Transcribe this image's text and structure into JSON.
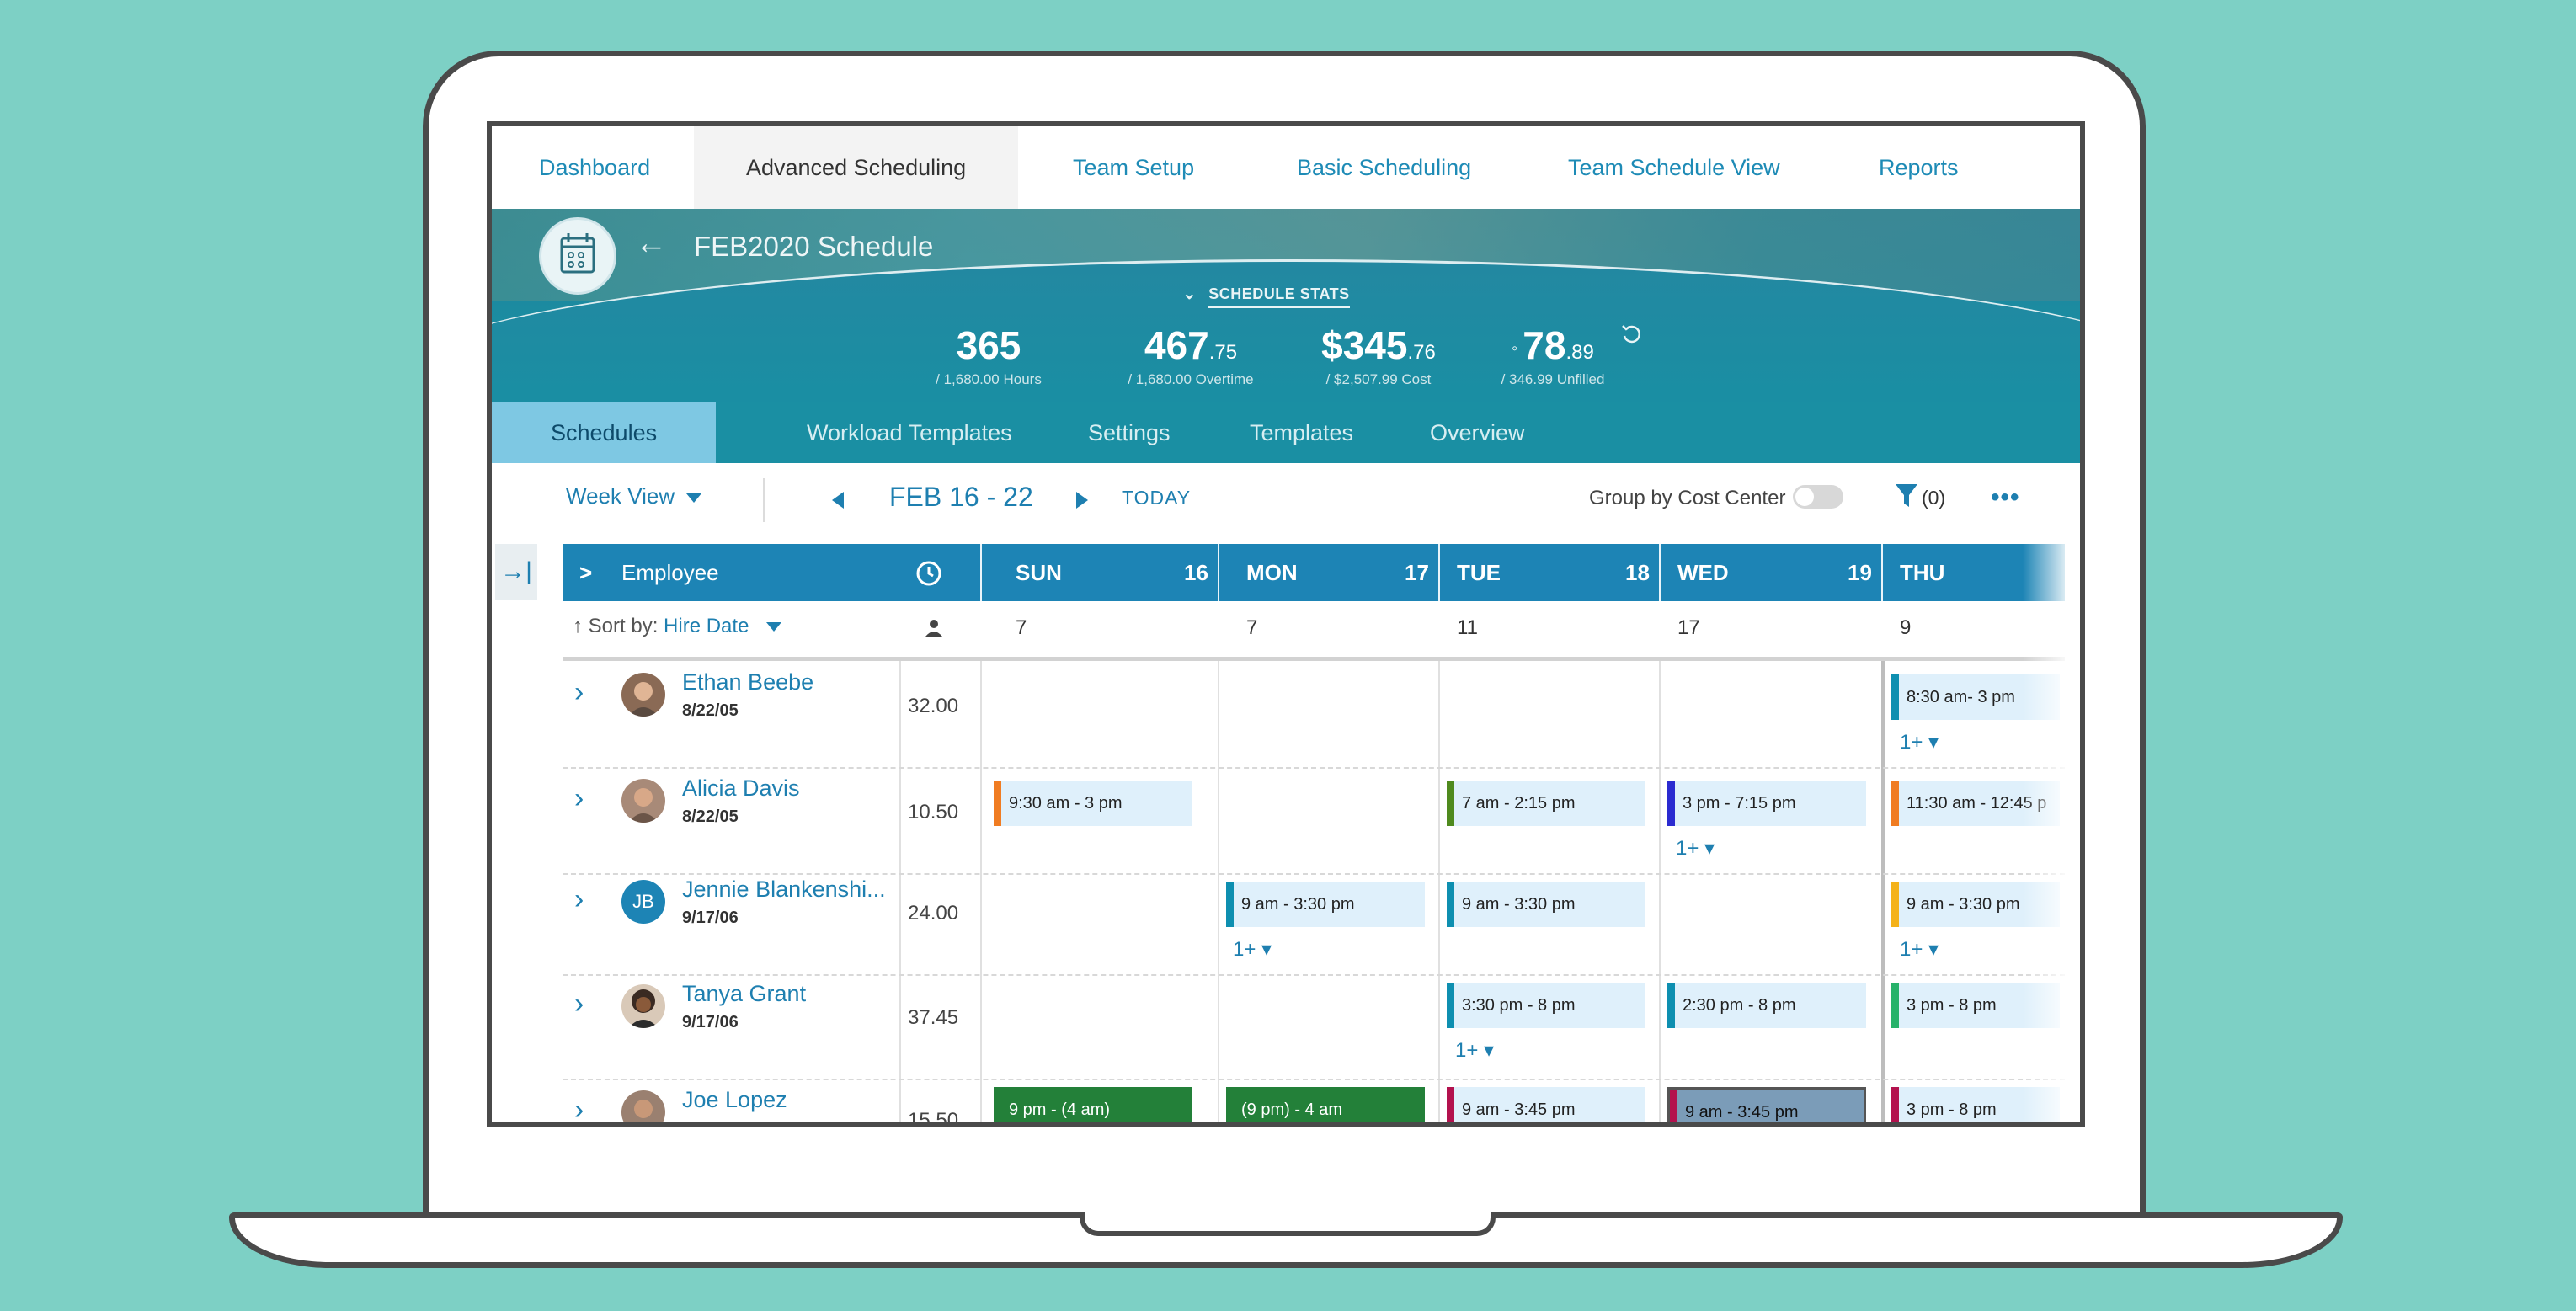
{
  "nav": {
    "items": [
      "Dashboard",
      "Advanced Scheduling",
      "Team Setup",
      "Basic Scheduling",
      "Team Schedule View",
      "Reports"
    ],
    "active": "Advanced Scheduling"
  },
  "banner": {
    "title": "FEB2020 Schedule",
    "stats_toggle": "SCHEDULE STATS",
    "stats": [
      {
        "main": "365",
        "dec": "",
        "sub": "/ 1,680.00 Hours"
      },
      {
        "main": "467",
        "dec": ".75",
        "sub": "/ 1,680.00 Overtime"
      },
      {
        "main": "$345",
        "dec": ".76",
        "sub": "/ $2,507.99 Cost"
      },
      {
        "main": "78",
        "dec": ".89",
        "sub": "/ 346.99 Unfilled"
      }
    ]
  },
  "subtabs": [
    "Schedules",
    "Workload Templates",
    "Settings",
    "Templates",
    "Overview"
  ],
  "toolbar": {
    "view": "Week View",
    "date_range": "FEB 16 - 22",
    "today": "TODAY",
    "group_label": "Group by Cost Center",
    "filter_count": "(0)",
    "more": "•••"
  },
  "grid": {
    "employee_header": "Employee",
    "days": [
      {
        "name": "SUN",
        "num": "16",
        "count": "7"
      },
      {
        "name": "MON",
        "num": "17",
        "count": "7"
      },
      {
        "name": "TUE",
        "num": "18",
        "count": "11"
      },
      {
        "name": "WED",
        "num": "19",
        "count": "17"
      },
      {
        "name": "THU",
        "num": "",
        "count": "9"
      }
    ],
    "sort_label": "Sort by:",
    "sort_value": "Hire Date",
    "more_label": "1+ ▾",
    "employees": [
      {
        "name": "Ethan Beebe",
        "date": "8/22/05",
        "hours": "32.00"
      },
      {
        "name": "Alicia Davis",
        "date": "8/22/05",
        "hours": "10.50"
      },
      {
        "name": "Jennie Blankenshi...",
        "date": "9/17/06",
        "hours": "24.00",
        "initials": "JB"
      },
      {
        "name": "Tanya Grant",
        "date": "9/17/06",
        "hours": "37.45"
      },
      {
        "name": "Joe Lopez",
        "date": "",
        "hours": "15.50"
      }
    ],
    "shifts": {
      "ethan_thu": "8:30 am- 3 pm",
      "alicia_sun": "9:30 am - 3 pm",
      "alicia_tue": "7 am - 2:15 pm",
      "alicia_wed": "3 pm - 7:15 pm",
      "alicia_thu": "11:30 am - 12:45 p",
      "jennie_mon": "9 am - 3:30 pm",
      "jennie_tue": "9 am - 3:30 pm",
      "jennie_thu": "9 am - 3:30 pm",
      "tanya_tue": "3:30 pm - 8 pm",
      "tanya_wed": "2:30 pm - 8 pm",
      "tanya_thu": "3 pm - 8 pm",
      "joe_sun": "9 pm - (4 am)",
      "joe_mon": "(9 pm) - 4 am",
      "joe_tue": "9 am - 3:45 pm",
      "joe_wed": "9 am - 3:45 pm",
      "joe_thu": "3 pm - 8 pm"
    }
  },
  "colors": {
    "background": "#7dd0c5",
    "accent": "#1d84b5",
    "orange": "#f07c22",
    "olive": "#4f8a1e",
    "indigo": "#2b2bd0",
    "teal": "#0e8fb0",
    "yellow": "#f4b21a",
    "green": "#27b26a",
    "crimson": "#b3124e",
    "dark_green": "#238039"
  }
}
